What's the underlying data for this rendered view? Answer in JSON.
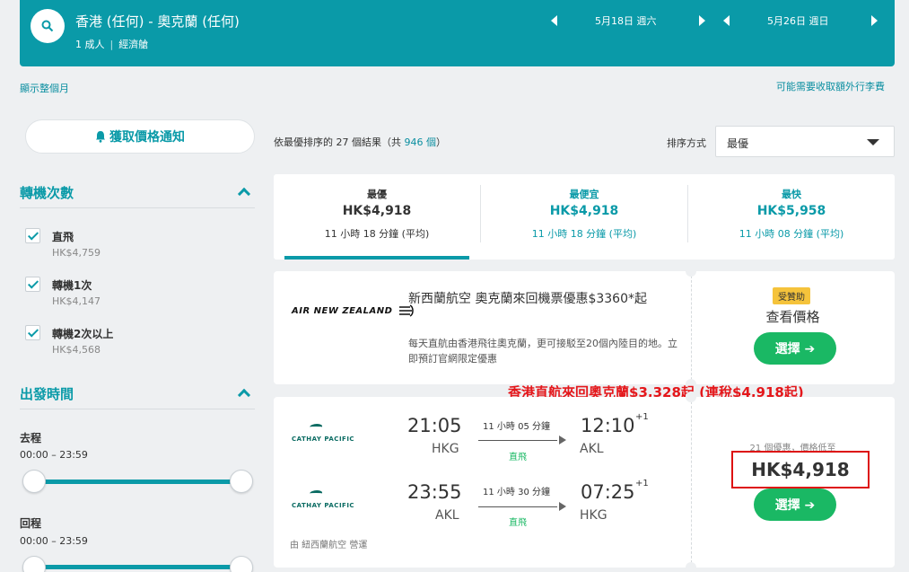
{
  "search": {
    "route": "香港 (任何) - 奧克蘭 (任何)",
    "passengers": "1 成人",
    "cabin": "經濟艙",
    "depart_date": "5月18日 週六",
    "return_date": "5月26日 週日"
  },
  "links": {
    "show_month": "顯示整個月",
    "extra_fees": "可能需要收取額外行李費"
  },
  "sidebar": {
    "alert_label": "獲取價格通知",
    "stops_title": "轉機次數",
    "stops": [
      {
        "label": "直飛",
        "price": "HK$4,759"
      },
      {
        "label": "轉機1次",
        "price": "HK$4,147"
      },
      {
        "label": "轉機2次以上",
        "price": "HK$4,568"
      }
    ],
    "times_title": "出發時間",
    "outbound_label": "去程",
    "outbound_range": "00:00 – 23:59",
    "return_label": "回程",
    "return_range": "00:00 – 23:59"
  },
  "results": {
    "count_prefix": "依最優排序的 27 個結果（共",
    "count_total": "946 個",
    "count_suffix": "）",
    "sort_label": "排序方式",
    "sort_value": "最優"
  },
  "tabs": [
    {
      "name": "最優",
      "price": "HK$4,918",
      "duration": "11 小時 18 分鐘 (平均)"
    },
    {
      "name": "最便宜",
      "price": "HK$4,918",
      "duration": "11 小時 18 分鐘 (平均)"
    },
    {
      "name": "最快",
      "price": "HK$5,958",
      "duration": "11 小時 08 分鐘 (平均)"
    }
  ],
  "ad": {
    "logo": "AIR NEW ZEALAND",
    "title": "新西蘭航空 奧克蘭來回機票優惠$3360*起",
    "description": "每天直航由香港飛往奧克蘭，更可接駁至20個內陸目的地。立即預訂官網限定優惠",
    "sponsor": "受贊助",
    "view_price": "查看價格",
    "select": "選擇 ➔"
  },
  "promo": "香港直航來回奧克蘭$3,328起 (連稅$4,918起)",
  "flight": {
    "airline": "CATHAY PACIFIC",
    "out": {
      "dep": "21:05",
      "from": "HKG",
      "duration": "11 小時 05 分鐘",
      "stops": "直飛",
      "arr": "12:10",
      "plus": "+1",
      "to": "AKL"
    },
    "ret": {
      "dep": "23:55",
      "from": "AKL",
      "duration": "11 小時 30 分鐘",
      "stops": "直飛",
      "arr": "07:25",
      "plus": "+1",
      "to": "HKG"
    },
    "operated": "由 紐西蘭航空 營運",
    "deals": "21 個優惠，價格低至",
    "price": "HK$4,918",
    "select": "選擇 ➔"
  }
}
